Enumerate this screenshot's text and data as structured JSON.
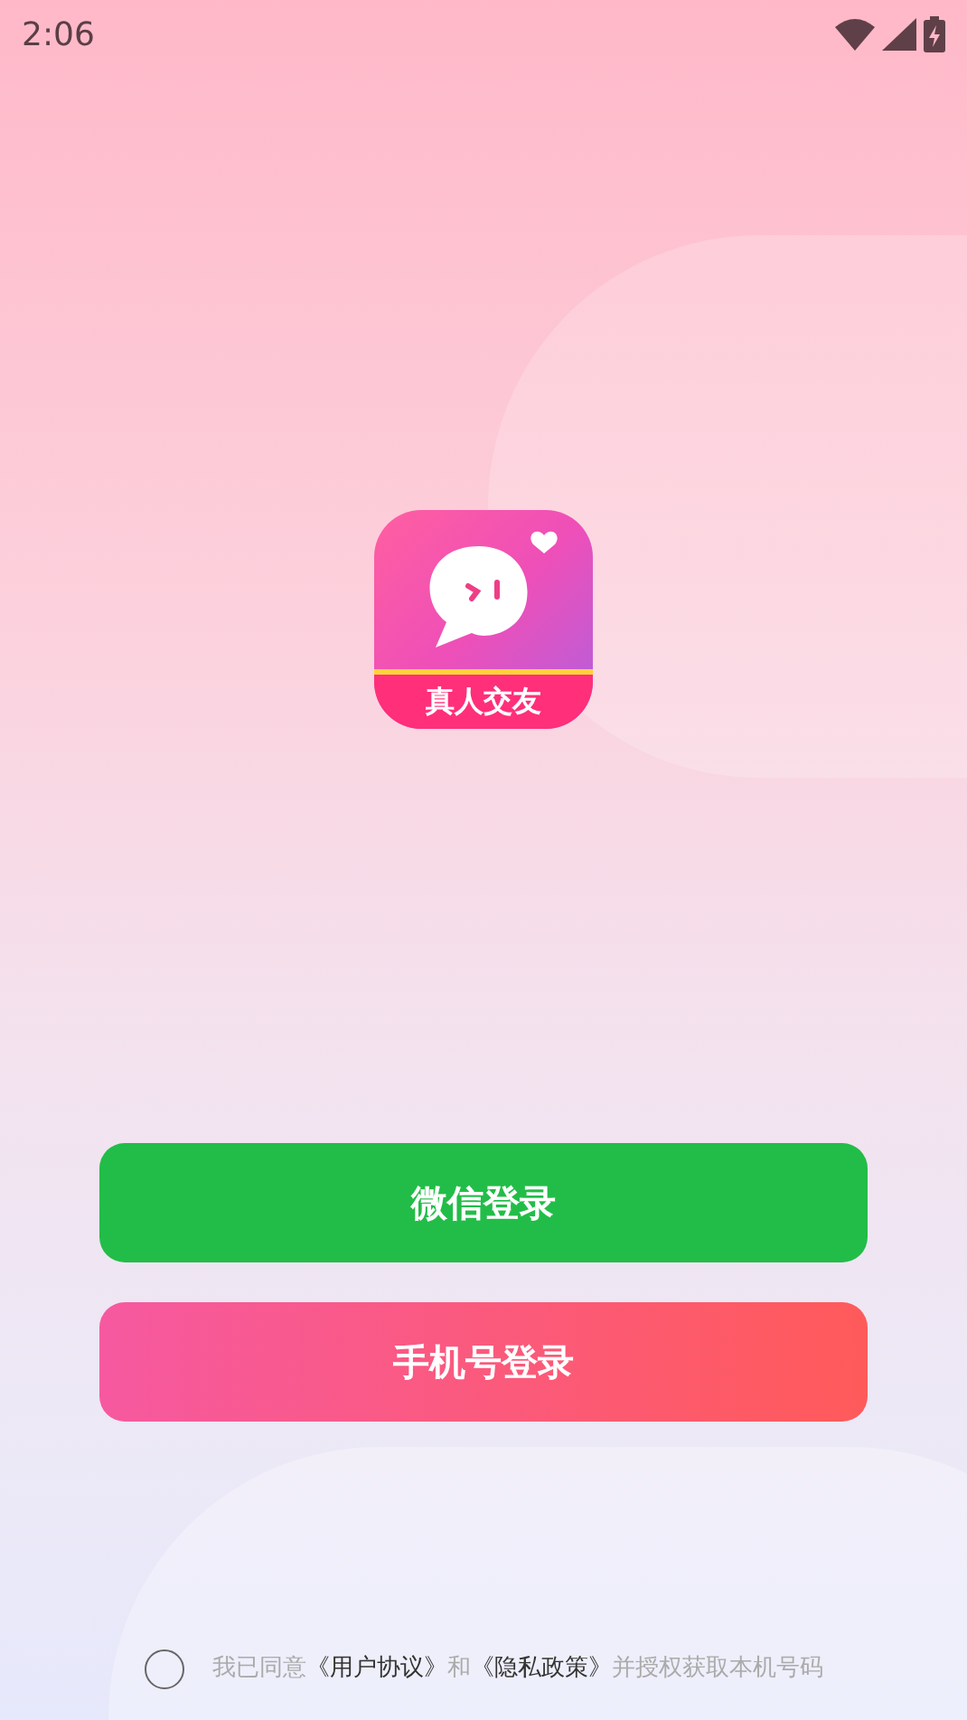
{
  "status_bar": {
    "time": "2:06"
  },
  "app_logo": {
    "caption": "真人交友"
  },
  "buttons": [
    {
      "kind": "wechat",
      "label": "微信登录"
    },
    {
      "kind": "phone",
      "label": "手机号登录"
    }
  ],
  "agreement": {
    "checked": false,
    "parts": [
      {
        "kind": "text",
        "text": "我已同意"
      },
      {
        "kind": "link",
        "text": "《用户协议》"
      },
      {
        "kind": "text",
        "text": "和"
      },
      {
        "kind": "link",
        "text": "《隐私政策》"
      },
      {
        "kind": "text",
        "text": "并授权获取本机号码"
      }
    ]
  }
}
